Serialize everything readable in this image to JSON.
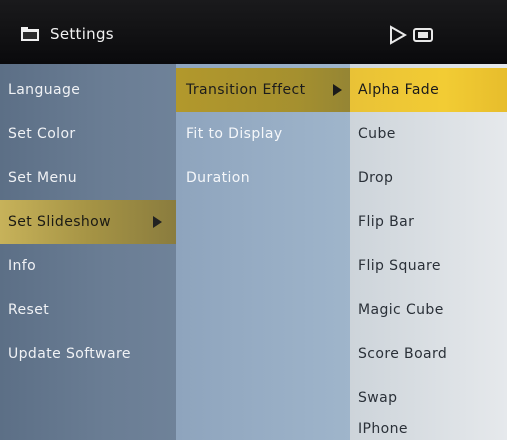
{
  "header": {
    "title": "Settings",
    "icons": [
      "folder-icon",
      "play-icon",
      "battery-icon"
    ]
  },
  "menu": {
    "items": [
      {
        "label": "Language"
      },
      {
        "label": "Set Color"
      },
      {
        "label": "Set Menu"
      },
      {
        "label": "Set Slideshow",
        "selected": true,
        "has_submenu": true
      },
      {
        "label": "Info"
      },
      {
        "label": "Reset"
      },
      {
        "label": "Update Software"
      }
    ]
  },
  "submenu": {
    "items": [
      {
        "label": "Transition Effect",
        "selected": true,
        "has_submenu": true
      },
      {
        "label": "Fit to Display"
      },
      {
        "label": "Duration"
      }
    ]
  },
  "options": {
    "items": [
      {
        "label": "Alpha Fade",
        "selected": true
      },
      {
        "label": "Cube"
      },
      {
        "label": "Drop"
      },
      {
        "label": "Flip Bar"
      },
      {
        "label": "Flip Square"
      },
      {
        "label": "Magic Cube"
      },
      {
        "label": "Score Board"
      },
      {
        "label": "Swap"
      },
      {
        "label": "IPhone"
      }
    ]
  },
  "colors": {
    "selection_highlight": "#f2cc34",
    "selection_path": "#a5902f",
    "menu_bg": "#6a7d94",
    "submenu_bg": "#9fb5cb",
    "options_bg": "#e6e9ec"
  }
}
